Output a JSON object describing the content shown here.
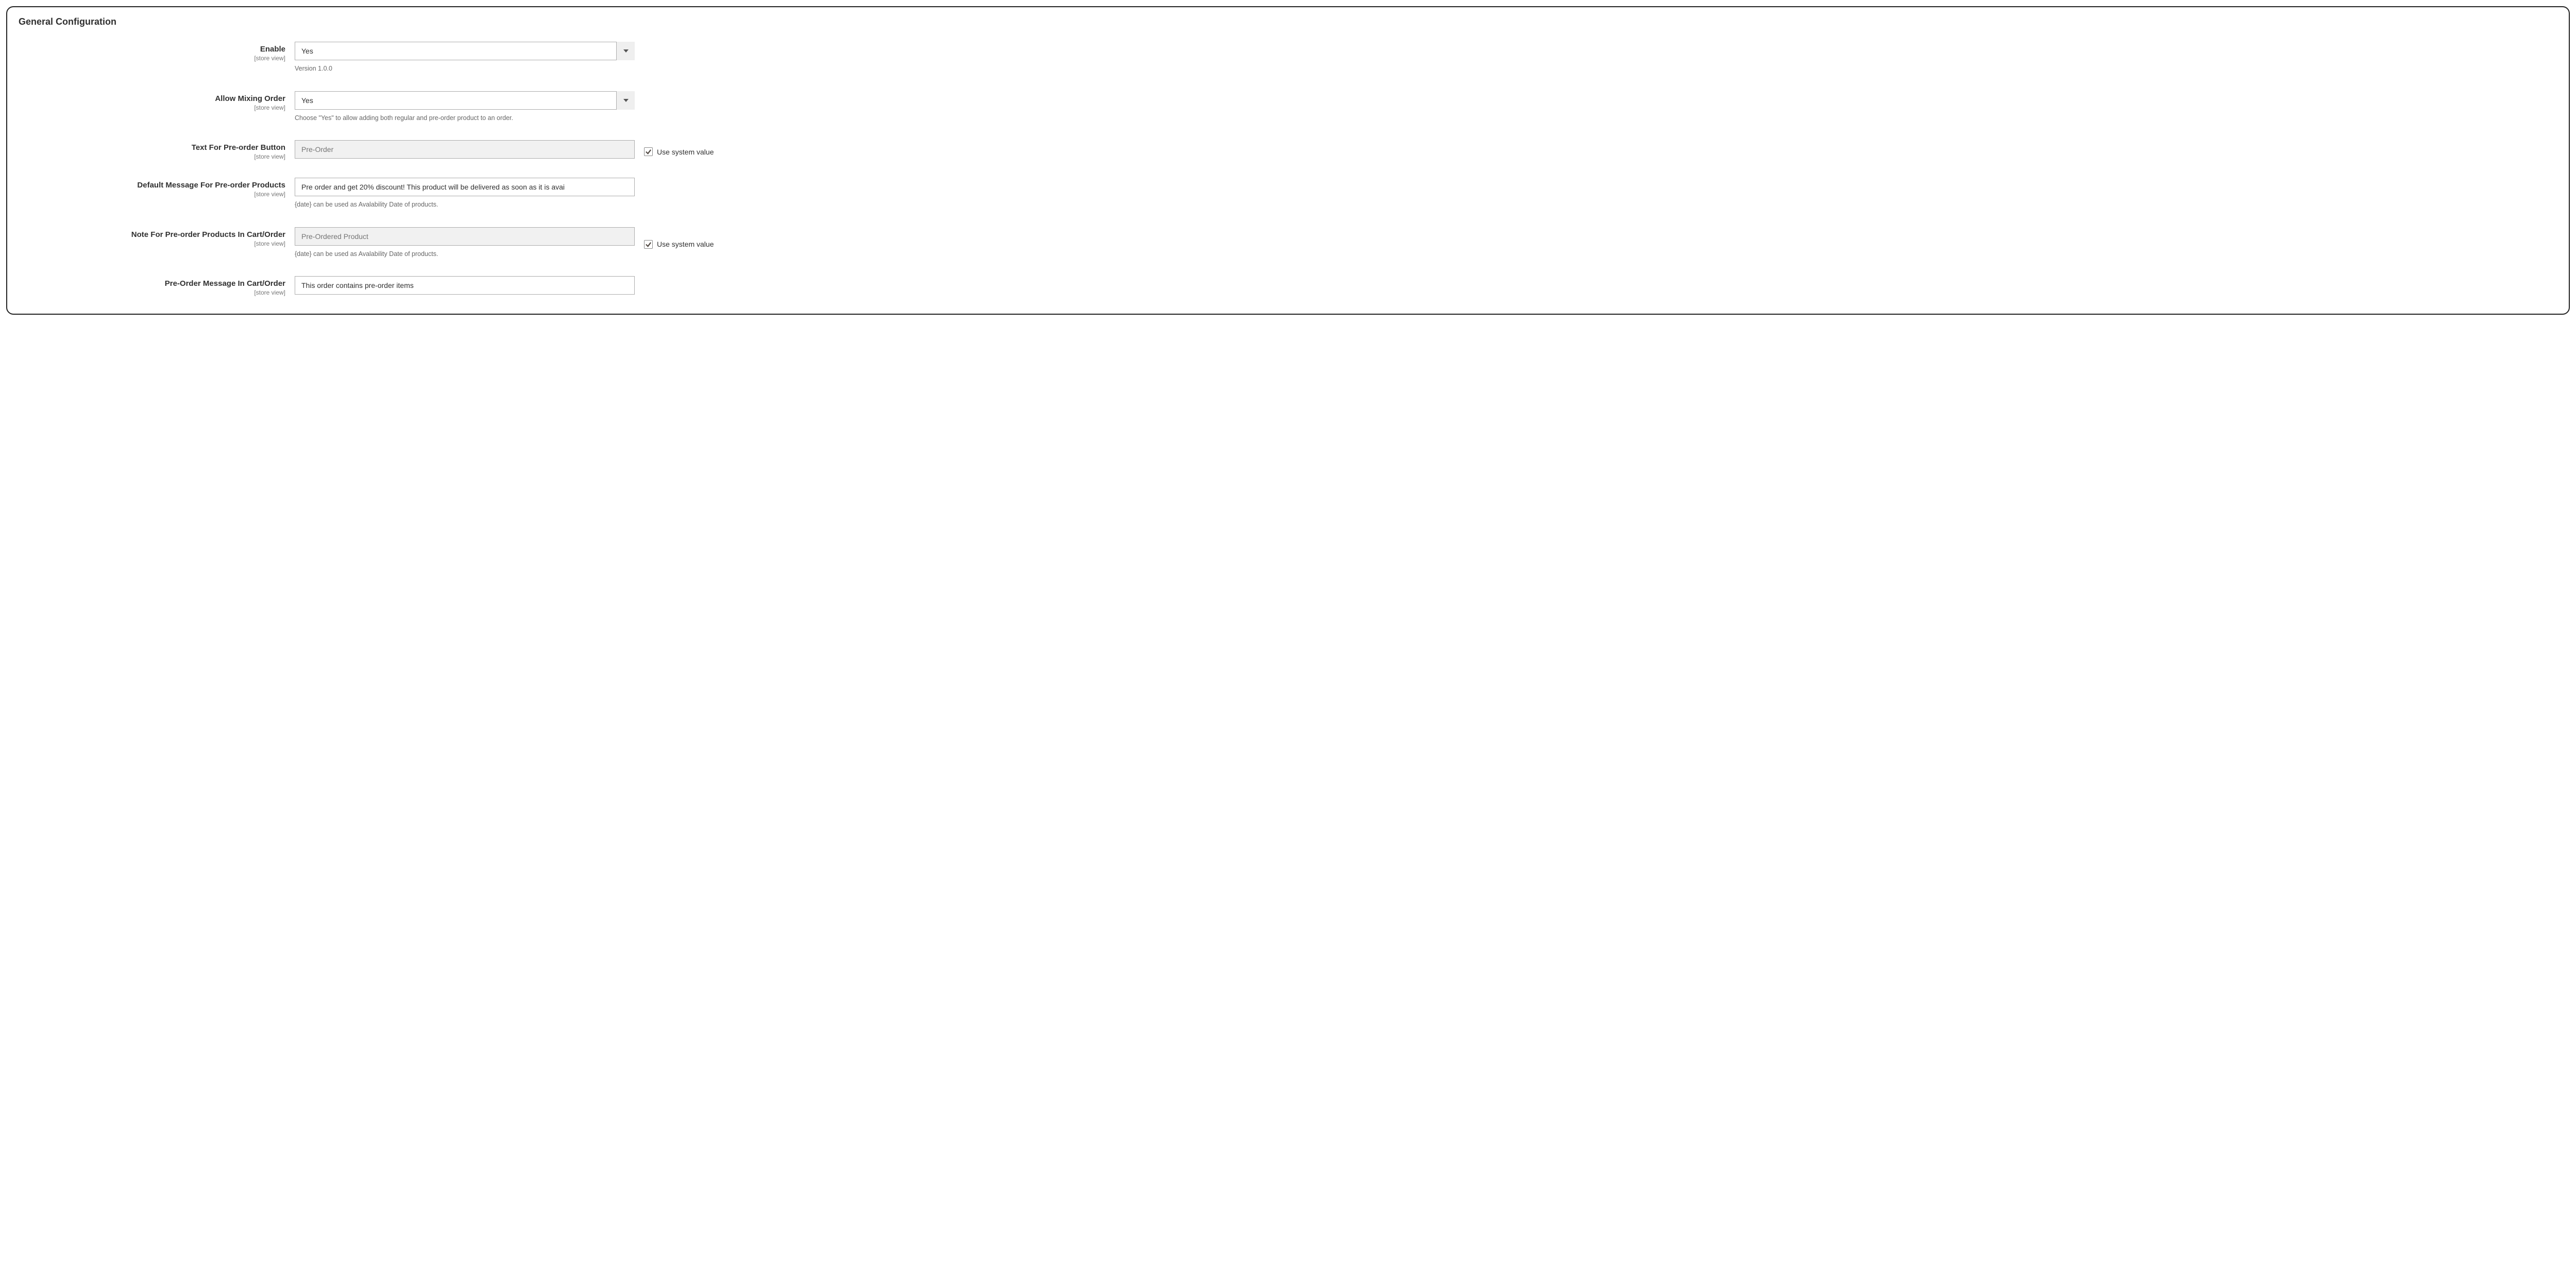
{
  "section": {
    "title": "General Configuration"
  },
  "scope_label": "[store view]",
  "use_system_value_label": "Use system value",
  "fields": {
    "enable": {
      "label": "Enable",
      "value": "Yes",
      "helper": "Version 1.0.0"
    },
    "allow_mixing": {
      "label": "Allow Mixing Order",
      "value": "Yes",
      "helper": "Choose \"Yes\" to allow adding both regular and pre-order product to an order."
    },
    "button_text": {
      "label": "Text For Pre-order Button",
      "placeholder": "Pre-Order",
      "use_system": true
    },
    "default_message": {
      "label": "Default Message For Pre-order Products",
      "value": "Pre order and get 20% discount! This product will be delivered as soon as it is avai",
      "helper": "{date} can be used as Avalability Date of products."
    },
    "cart_note": {
      "label": "Note For Pre-order Products In Cart/Order",
      "placeholder": "Pre-Ordered Product",
      "helper": "{date} can be used as Avalability Date of products.",
      "use_system": true
    },
    "cart_message": {
      "label": "Pre-Order Message In Cart/Order",
      "value": "This order contains pre-order items"
    }
  }
}
